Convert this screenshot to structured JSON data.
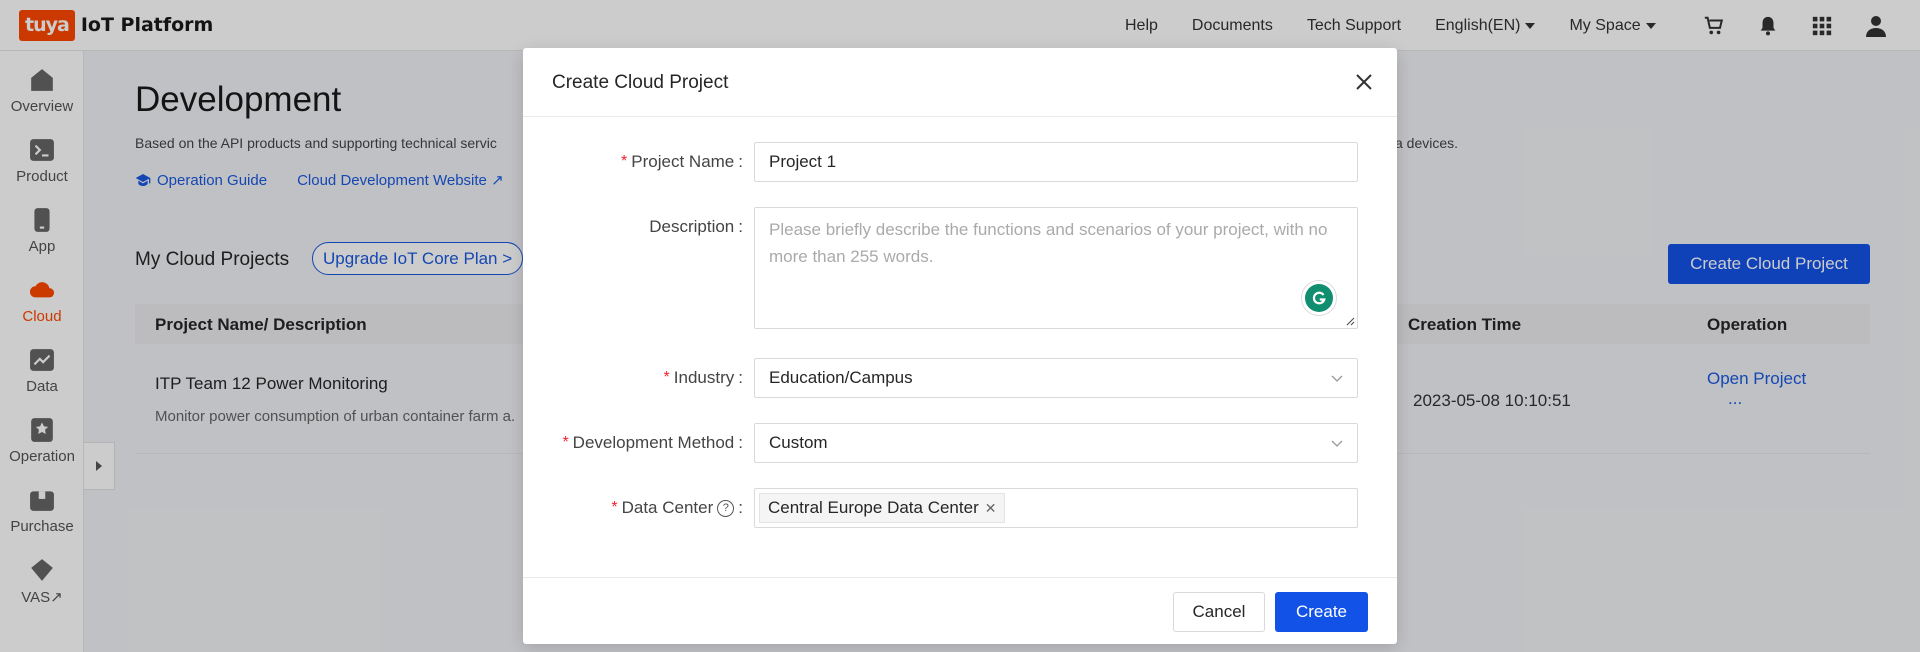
{
  "brand": {
    "badge": "tuya",
    "title": "IoT Platform"
  },
  "topnav": {
    "help": "Help",
    "documents": "Documents",
    "tech_support": "Tech Support",
    "language": "English(EN)",
    "space": "My Space"
  },
  "sidebar": {
    "items": [
      {
        "label": "Overview",
        "icon": "home-icon"
      },
      {
        "label": "Product",
        "icon": "terminal-icon"
      },
      {
        "label": "App",
        "icon": "phone-icon"
      },
      {
        "label": "Cloud",
        "icon": "cloud-icon",
        "active": true
      },
      {
        "label": "Data",
        "icon": "chart-icon"
      },
      {
        "label": "Operation",
        "icon": "bookmark-icon"
      },
      {
        "label": "Purchase",
        "icon": "box-icon"
      },
      {
        "label": "VAS",
        "icon": "diamond-icon",
        "external": "↗"
      }
    ]
  },
  "page": {
    "title": "Development",
    "description": "Based on the API products and supporting technical servic",
    "description_tail": "ya devices.",
    "links": {
      "guide": "Operation Guide",
      "website": "Cloud Development Website",
      "external": "↗"
    },
    "section_title": "My Cloud Projects",
    "upgrade": "Upgrade IoT Core Plan",
    "upgrade_chevron": ">",
    "create_button": "Create Cloud Project",
    "table": {
      "headers": {
        "name": "Project Name/ Description",
        "time": "Creation Time",
        "operation": "Operation"
      },
      "rows": [
        {
          "name": "ITP Team 12 Power Monitoring",
          "desc": "Monitor power consumption of urban container farm a.",
          "time": "2023-05-08 10:10:51",
          "open": "Open Project",
          "more": "..."
        }
      ]
    }
  },
  "modal": {
    "title": "Create Cloud Project",
    "fields": {
      "project_name": {
        "label": "Project Name",
        "value": "Project 1"
      },
      "description": {
        "label": "Description",
        "placeholder": "Please briefly describe the functions and scenarios of your project, with no more than 255 words."
      },
      "industry": {
        "label": "Industry",
        "value": "Education/Campus"
      },
      "dev_method": {
        "label": "Development Method",
        "value": "Custom"
      },
      "data_center": {
        "label": "Data Center",
        "tag": "Central Europe Data Center",
        "help": "?"
      }
    },
    "required_mark": "*",
    "colon": ":",
    "cancel": "Cancel",
    "create": "Create"
  },
  "colors": {
    "brand": "#ff4800",
    "primary": "#1352e6",
    "link": "#1a59e0"
  }
}
